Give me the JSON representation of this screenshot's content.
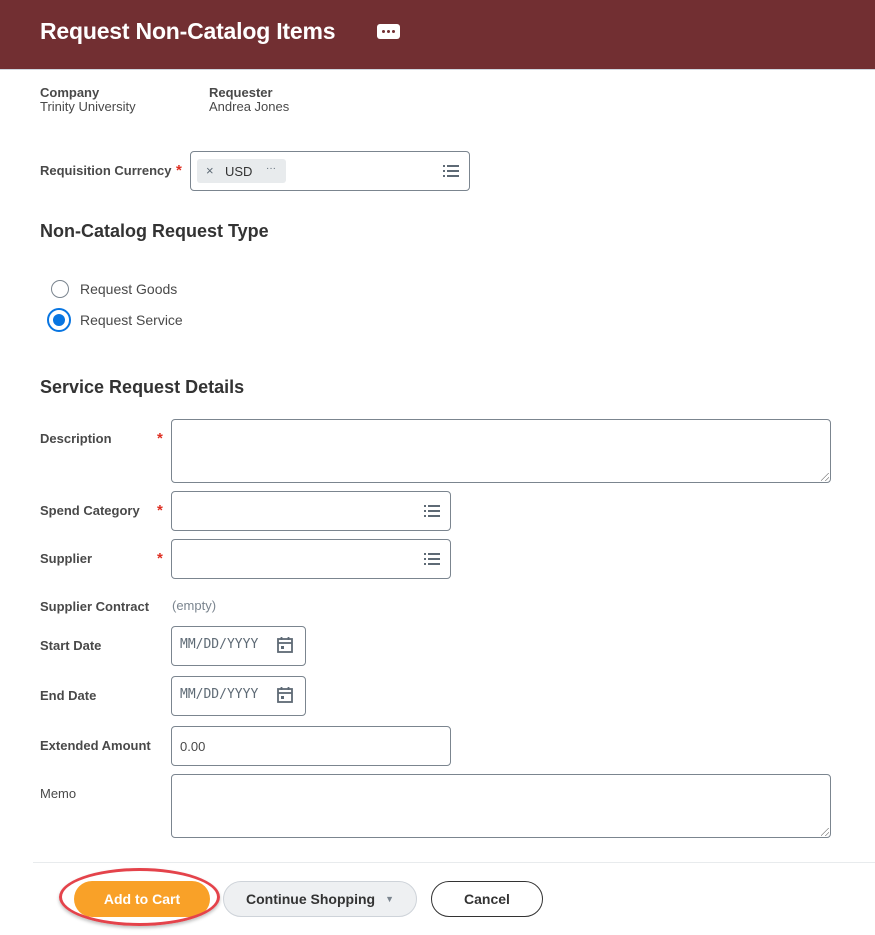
{
  "header": {
    "title": "Request Non-Catalog Items",
    "menu_icon": "related-actions-icon"
  },
  "meta": {
    "company_label": "Company",
    "company_value": "Trinity University",
    "requester_label": "Requester",
    "requester_value": "Andrea Jones"
  },
  "currency": {
    "label": "Requisition Currency",
    "required": "*",
    "selected": "USD",
    "remove_icon": "×",
    "more_icon": "···"
  },
  "request_type": {
    "heading": "Non-Catalog Request Type",
    "options": [
      {
        "label": "Request Goods",
        "selected": false
      },
      {
        "label": "Request Service",
        "selected": true
      }
    ]
  },
  "details": {
    "heading": "Service Request Details",
    "description": {
      "label": "Description",
      "required": "*",
      "value": ""
    },
    "spend_category": {
      "label": "Spend Category",
      "required": "*",
      "value": ""
    },
    "supplier": {
      "label": "Supplier",
      "required": "*",
      "value": ""
    },
    "supplier_contract": {
      "label": "Supplier Contract",
      "value": "(empty)"
    },
    "start_date": {
      "label": "Start Date",
      "placeholder": "MM/DD/YYYY"
    },
    "end_date": {
      "label": "End Date",
      "placeholder": "MM/DD/YYYY"
    },
    "extended_amount": {
      "label": "Extended Amount",
      "value": "0.00"
    },
    "memo": {
      "label": "Memo",
      "value": ""
    }
  },
  "footer": {
    "add_to_cart": "Add to Cart",
    "continue_shopping": "Continue Shopping",
    "cancel": "Cancel"
  },
  "colors": {
    "header_bg": "#722f32",
    "primary_button": "#f9a128",
    "radio_selected": "#0875e1",
    "required_star": "#de2e21",
    "highlight_ring": "#e4434b"
  }
}
